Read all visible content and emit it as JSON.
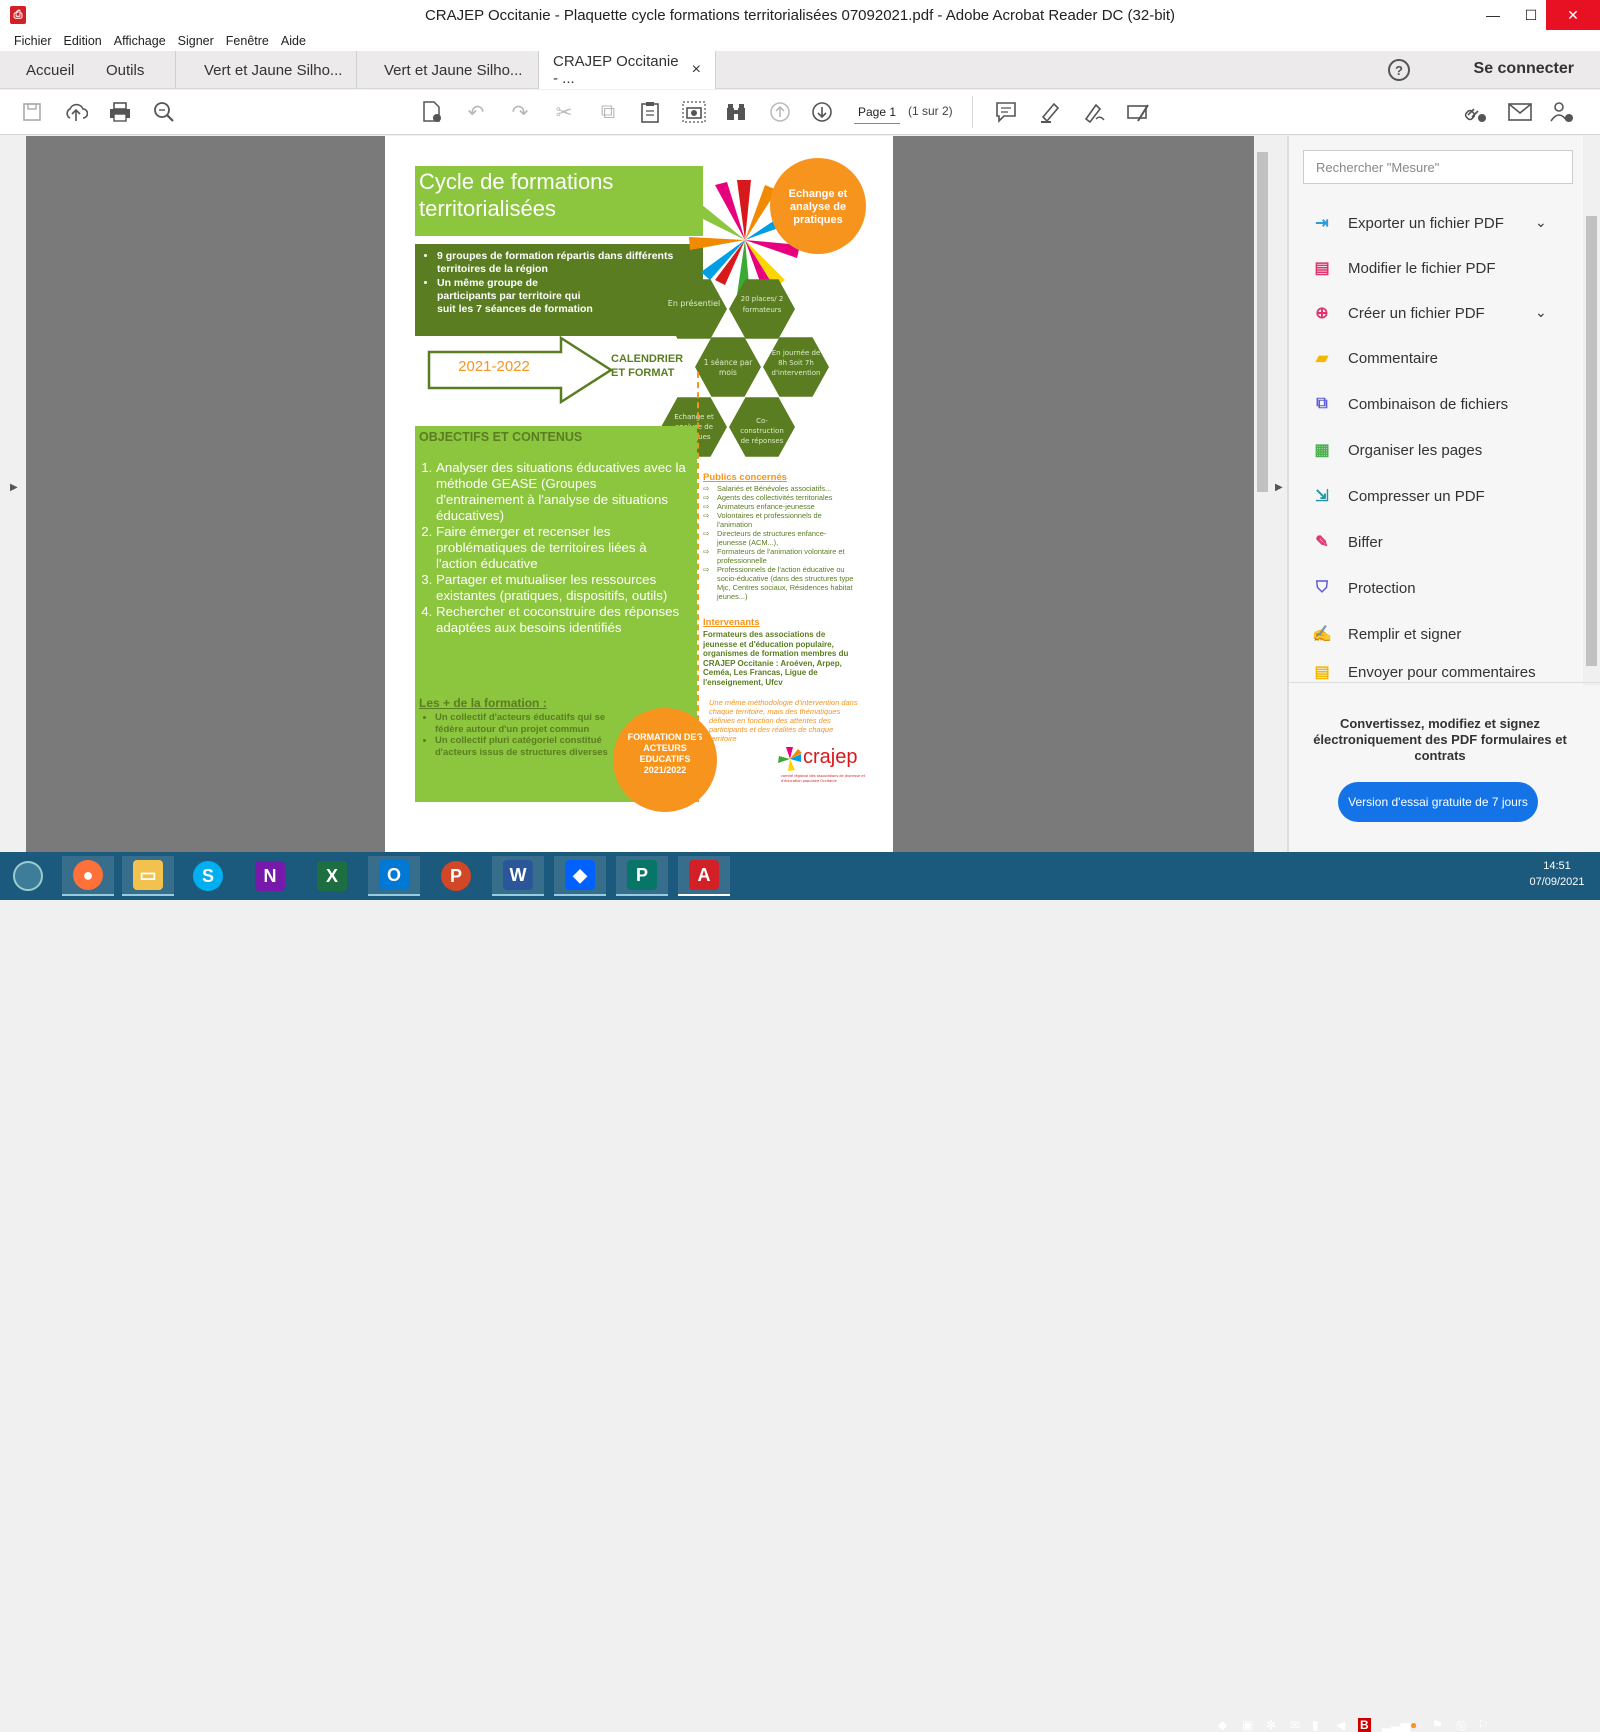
{
  "window": {
    "title": "CRAJEP Occitanie - Plaquette cycle formations territorialisées 07092021.pdf - Adobe Acrobat Reader DC (32-bit)",
    "minimize": "—",
    "maximize": "☐",
    "close": "✕"
  },
  "menu": [
    "Fichier",
    "Edition",
    "Affichage",
    "Signer",
    "Fenêtre",
    "Aide"
  ],
  "tabs": {
    "home": "Accueil",
    "tools": "Outils",
    "doc1": "Vert et Jaune Silho...",
    "doc2": "Vert et Jaune Silho...",
    "doc3": "CRAJEP Occitanie - ...",
    "close": "×"
  },
  "header": {
    "help": "?",
    "signin": "Se connecter"
  },
  "toolbar": {
    "page_value": "Page 1",
    "page_count": "(1 sur 2)"
  },
  "right_panel": {
    "search_placeholder": "Rechercher \"Mesure\"",
    "items": [
      {
        "label": "Exporter un fichier PDF",
        "icon": "export-pdf-icon",
        "color": "#2d9cdb"
      },
      {
        "label": "Modifier le fichier PDF",
        "icon": "edit-pdf-icon",
        "color": "#e0336e"
      },
      {
        "label": "Créer un fichier PDF",
        "icon": "create-pdf-icon",
        "color": "#e0336e"
      },
      {
        "label": "Commentaire",
        "icon": "comment-icon",
        "color": "#f5b800"
      },
      {
        "label": "Combinaison de fichiers",
        "icon": "combine-files-icon",
        "color": "#5b5bd6"
      },
      {
        "label": "Organiser les pages",
        "icon": "organize-pages-icon",
        "color": "#4caf50"
      },
      {
        "label": "Compresser un PDF",
        "icon": "compress-pdf-icon",
        "color": "#2196a6"
      },
      {
        "label": "Biffer",
        "icon": "redact-icon",
        "color": "#e0336e"
      },
      {
        "label": "Protection",
        "icon": "protect-icon",
        "color": "#5b5bd6"
      },
      {
        "label": "Remplir et signer",
        "icon": "fill-sign-icon",
        "color": "#8e44ad"
      },
      {
        "label": "Envoyer pour commentaires",
        "icon": "send-comments-icon",
        "color": "#f5b800"
      }
    ],
    "promo": "Convertissez, modifiez et signez électroniquement des PDF formulaires et contrats",
    "trial_button": "Version d'essai gratuite de 7 jours"
  },
  "poster": {
    "title": "Cycle de formations territorialisées",
    "intro": [
      "9 groupes de formation répartis dans différents territoires de la région",
      "Un même groupe de participants par territoire qui suit les 7 séances de formation"
    ],
    "year": "2021-2022",
    "calendar": "CALENDRIER ET FORMAT",
    "circle_top": "Echange et analyse de pratiques",
    "hexagons": [
      "En présentiel",
      "20 places/ 2 formateurs",
      "1 séance par mois",
      "En journée de 8h Soit 7h d'intervention",
      "Echange et analyse de pratiques",
      "Co-construction de réponses"
    ],
    "objectives_title": "OBJECTIFS ET CONTENUS",
    "objectives": [
      "Analyser des situations éducatives avec la méthode GEASE (Groupes d'entrainement à l'analyse de situations éducatives)",
      "Faire émerger et recenser les problématiques de territoires liées à l'action éducative",
      "Partager et mutualiser les ressources existantes (pratiques, dispositifs, outils)",
      "Rechercher et coconstruire des réponses adaptées aux besoins identifiés"
    ],
    "plus_title": "Les + de la formation :",
    "plus": [
      "Un collectif d'acteurs éducatifs qui se fédère autour d'un projet commun",
      "Un collectif pluri catégoriel constitué d'acteurs issus de structures diverses"
    ],
    "circle_bottom": "FORMATION DES ACTEURS EDUCATIFS 2021/2022",
    "publics_title": "Publics concernés",
    "publics": [
      "Salariés et Bénévoles associatifs...",
      "Agents des collectivités territoriales",
      "Animateurs enfance-jeunesse",
      "Volontaires et professionnels de l'animation",
      "Directeurs de structures enfance-jeunesse (ACM...),",
      "Formateurs de l'animation volontaire et professionnelle",
      "Professionnels de l'action éducative ou socio-éducative (dans des structures type Mjc, Centres sociaux, Résidences habitat jeunes...)"
    ],
    "intervenants_title": "Intervenants",
    "intervenants": "Formateurs des associations de jeunesse et d'éducation populaire, organismes de formation membres du CRAJEP Occitanie : Aroéven, Arpep, Ceméa, Les Francas, Ligue de l'enseignement, Ufcv",
    "methodo": "Une même méthodologie d'intervention dans chaque territoire, mais des thématiques définies en fonction des attentes des participants et des réalités de chaque territoire",
    "logo": "crajep",
    "logo_sub": "comité régional des associations de jeunesse et d'éducation populaire Occitanie"
  },
  "taskbar": {
    "clock_time": "14:51",
    "clock_date": "07/09/2021"
  }
}
